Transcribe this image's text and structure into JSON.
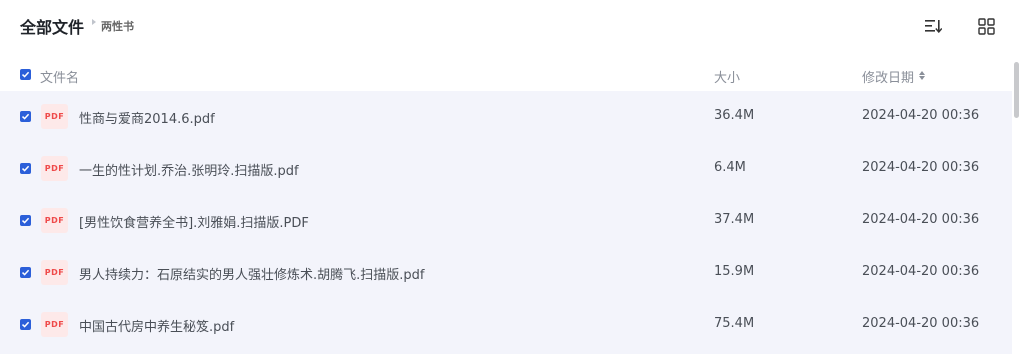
{
  "header": {
    "title": "全部文件",
    "breadcrumb": "两性书",
    "sort_icon": "sort-list-icon",
    "view_icon": "grid-view-icon"
  },
  "columns": {
    "name": "文件名",
    "size": "大小",
    "date": "修改日期"
  },
  "files": [
    {
      "icon_label": "PDF",
      "name": "性商与爱商2014.6.pdf",
      "size": "36.4M",
      "date": "2024-04-20 00:36",
      "checked": true
    },
    {
      "icon_label": "PDF",
      "name": "一生的性计划.乔治.张明玲.扫描版.pdf",
      "size": "6.4M",
      "date": "2024-04-20 00:36",
      "checked": true
    },
    {
      "icon_label": "PDF",
      "name": "[男性饮食营养全书].刘雅娟.扫描版.PDF",
      "size": "37.4M",
      "date": "2024-04-20 00:36",
      "checked": true
    },
    {
      "icon_label": "PDF",
      "name": "男人持续力：石原结实的男人强壮修炼术.胡腾飞.扫描版.pdf",
      "size": "15.9M",
      "date": "2024-04-20 00:36",
      "checked": true
    },
    {
      "icon_label": "PDF",
      "name": "中国古代房中养生秘笈.pdf",
      "size": "75.4M",
      "date": "2024-04-20 00:36",
      "checked": true
    }
  ],
  "colors": {
    "accent": "#2b5fd9",
    "list_bg": "#f3f4fb",
    "pdf_icon_bg": "#fde9e9",
    "pdf_icon_text": "#ef4a4a"
  }
}
